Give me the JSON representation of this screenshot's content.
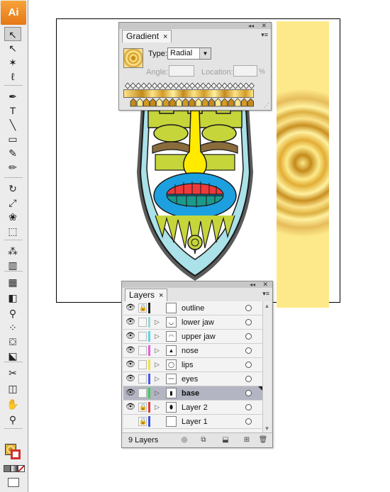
{
  "app": {
    "logo": "Ai"
  },
  "tools": [
    {
      "name": "selection-tool",
      "glyph": "↖",
      "active": true
    },
    {
      "name": "direct-selection-tool",
      "glyph": "↖"
    },
    {
      "name": "magic-wand-tool",
      "glyph": "✶"
    },
    {
      "name": "lasso-tool",
      "glyph": "ℓ"
    },
    {
      "name": "pen-tool",
      "glyph": "✒"
    },
    {
      "name": "type-tool",
      "glyph": "T"
    },
    {
      "name": "line-segment-tool",
      "glyph": "╲"
    },
    {
      "name": "rectangle-tool",
      "glyph": "▭"
    },
    {
      "name": "paintbrush-tool",
      "glyph": "✎"
    },
    {
      "name": "pencil-tool",
      "glyph": "✏"
    },
    {
      "name": "rotate-tool",
      "glyph": "↻"
    },
    {
      "name": "scale-tool",
      "glyph": "⤢"
    },
    {
      "name": "warp-tool",
      "glyph": "❀"
    },
    {
      "name": "free-transform-tool",
      "glyph": "⬚"
    },
    {
      "name": "symbol-sprayer-tool",
      "glyph": "⁂"
    },
    {
      "name": "column-graph-tool",
      "glyph": "▥"
    },
    {
      "name": "mesh-tool",
      "glyph": "▦"
    },
    {
      "name": "gradient-tool",
      "glyph": "◧"
    },
    {
      "name": "eyedropper-tool",
      "glyph": "⚲"
    },
    {
      "name": "blend-tool",
      "glyph": "⁘"
    },
    {
      "name": "live-paint-bucket-tool",
      "glyph": "⛋"
    },
    {
      "name": "live-paint-selection-tool",
      "glyph": "⬕"
    },
    {
      "name": "slice-tool",
      "glyph": "✂"
    },
    {
      "name": "eraser-tool",
      "glyph": "◫"
    },
    {
      "name": "hand-tool",
      "glyph": "✋"
    },
    {
      "name": "zoom-tool",
      "glyph": "⚲"
    }
  ],
  "gradient_panel": {
    "tab_label": "Gradient",
    "close_glyph": "×",
    "menu_glyph": "▾≡",
    "type_label": "Type:",
    "type_value": "Radial",
    "angle_label": "Angle:",
    "angle_value": "",
    "location_label": "Location:",
    "location_value": "",
    "percent_sign": "%",
    "colors": {
      "gold_light": "#fde98a",
      "gold_dark": "#c48a1a",
      "gold_mid": "#d59a22"
    }
  },
  "layers_panel": {
    "tab_label": "Layers",
    "close_glyph": "×",
    "menu_glyph": "▾≡",
    "layer_count_label": "9 Layers",
    "layers": [
      {
        "name": "outline",
        "color": "#1f1f1f",
        "visible": true,
        "locked": true,
        "expandable": false,
        "selected": false,
        "thumb": ""
      },
      {
        "name": "lower jaw",
        "color": "#9ad8d8",
        "visible": true,
        "locked": false,
        "expandable": true,
        "selected": false,
        "thumb": "◡"
      },
      {
        "name": "upper jaw",
        "color": "#5bd6e8",
        "visible": true,
        "locked": false,
        "expandable": true,
        "selected": false,
        "thumb": "◠"
      },
      {
        "name": "nose",
        "color": "#e65fd9",
        "visible": true,
        "locked": false,
        "expandable": true,
        "selected": false,
        "thumb": "▲"
      },
      {
        "name": "lips",
        "color": "#f1e544",
        "visible": true,
        "locked": false,
        "expandable": true,
        "selected": false,
        "thumb": "◯"
      },
      {
        "name": "eyes",
        "color": "#4b57e8",
        "visible": true,
        "locked": false,
        "expandable": true,
        "selected": false,
        "thumb": "〰"
      },
      {
        "name": "base",
        "color": "#3fce55",
        "visible": true,
        "locked": false,
        "expandable": true,
        "selected": true,
        "thumb": "▮"
      },
      {
        "name": "Layer 2",
        "color": "#e03b3b",
        "visible": true,
        "locked": true,
        "expandable": true,
        "selected": false,
        "thumb": "⬮"
      },
      {
        "name": "Layer 1",
        "color": "#3b4fe0",
        "visible": false,
        "locked": true,
        "expandable": false,
        "selected": false,
        "thumb": ""
      }
    ]
  }
}
